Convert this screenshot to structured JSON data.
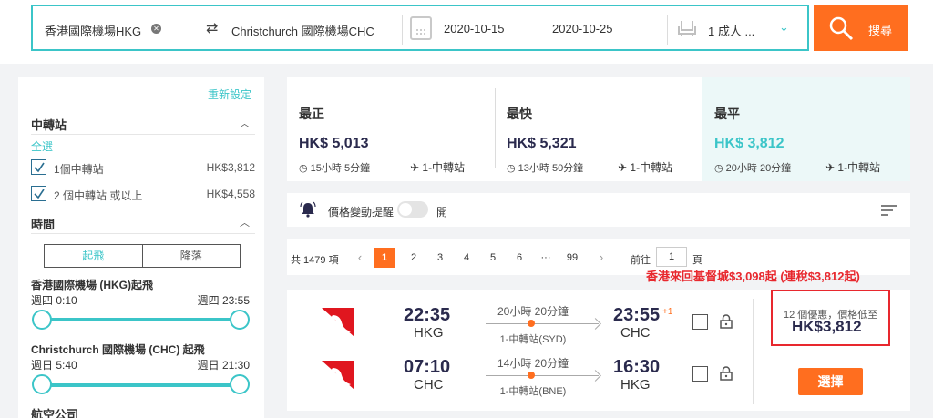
{
  "search": {
    "origin": "香港國際機場HKG",
    "destination": "Christchurch 國際機場CHC",
    "depart_date": "2020-10-15",
    "return_date": "2020-10-25",
    "passengers": "1 成人 ...",
    "search_label": "搜尋"
  },
  "sidebar": {
    "reset": "重新設定",
    "transfer": {
      "title": "中轉站",
      "select_all": "全選",
      "options": [
        {
          "label": "1個中轉站",
          "price": "HK$3,812",
          "checked": true
        },
        {
          "label": "2 個中轉站 或以上",
          "price": "HK$4,558",
          "checked": true
        }
      ]
    },
    "time": {
      "title": "時間",
      "tabs": [
        "起飛",
        "降落"
      ],
      "ranges": [
        {
          "title": "香港國際機場 (HKG)起飛",
          "from": "週四 0:10",
          "to": "週四 23:55"
        },
        {
          "title": "Christchurch 國際機場 (CHC) 起飛",
          "from": "週日 5:40",
          "to": "週日 21:30"
        }
      ]
    },
    "airline_title": "航空公司"
  },
  "summary": [
    {
      "label": "最正",
      "price": "HK$ 5,013",
      "duration": "15小時 5分鐘",
      "stops": "1-中轉站"
    },
    {
      "label": "最快",
      "price": "HK$ 5,321",
      "duration": "13小時 50分鐘",
      "stops": "1-中轉站"
    },
    {
      "label": "最平",
      "price": "HK$ 3,812",
      "duration": "20小時 20分鐘",
      "stops": "1-中轉站"
    }
  ],
  "alert": {
    "label": "價格變動提醒",
    "state": "開"
  },
  "pagination": {
    "total": "共 1479 項",
    "pages": [
      "1",
      "2",
      "3",
      "4",
      "5",
      "6",
      "···",
      "99"
    ],
    "goto_label": "前往",
    "goto_value": "1",
    "page_label": "頁",
    "prev": "‹",
    "next": "›"
  },
  "promo": "香港來回基督城$3,098起 (連稅$3,812起)",
  "result": {
    "legs": [
      {
        "dep_time": "22:35",
        "dep_code": "HKG",
        "duration": "20小時 20分鐘",
        "stop": "1-中轉站(SYD)",
        "arr_time": "23:55",
        "plus": "+1",
        "arr_code": "CHC"
      },
      {
        "dep_time": "07:10",
        "dep_code": "CHC",
        "duration": "14小時 20分鐘",
        "stop": "1-中轉站(BNE)",
        "arr_time": "16:30",
        "plus": "",
        "arr_code": "HKG"
      }
    ],
    "deal_text": "12 個優惠，價格低至",
    "deal_price": "HK$3,812",
    "choose": "選擇"
  },
  "colors": {
    "accent": "#3bc5c8",
    "orange": "#ff6e1f",
    "red": "#e8282e",
    "navy": "#2a2a4d"
  }
}
